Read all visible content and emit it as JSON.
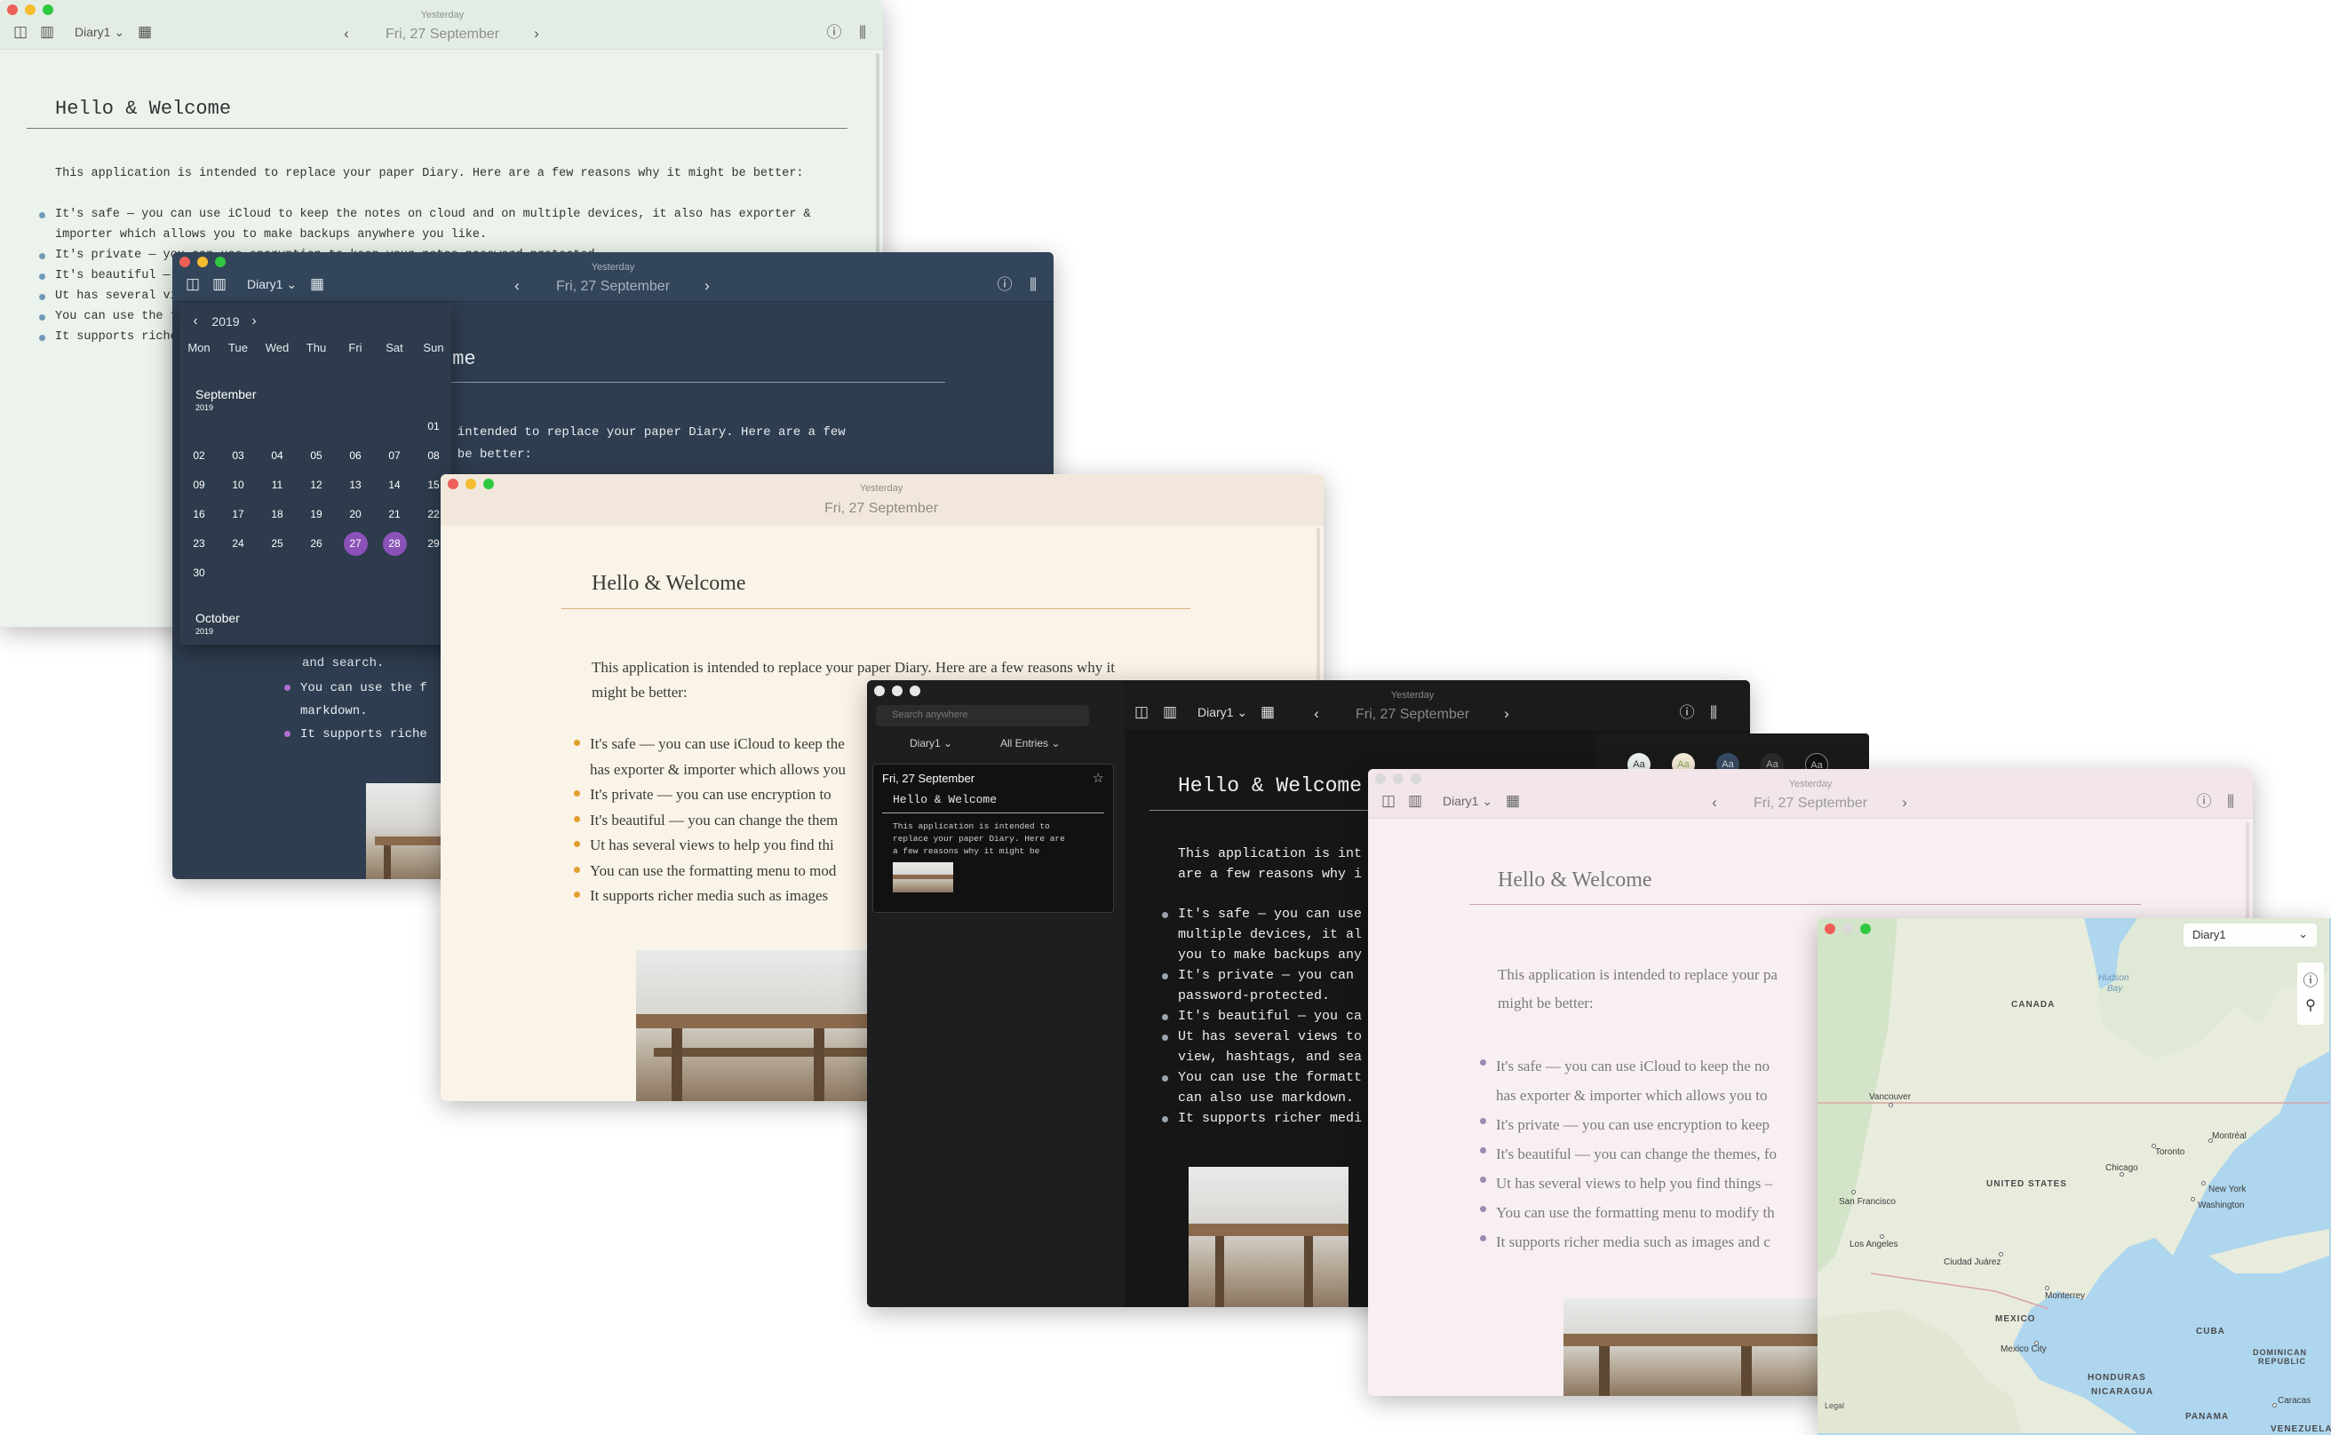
{
  "common": {
    "yesterday": "Yesterday",
    "date": "Fri, 27 September",
    "diary": "Diary1",
    "heading": "Hello & Welcome",
    "intro": "This application is intended to replace your paper Diary. Here are a few reasons why it might be better:",
    "intro_split_a": "This application is intended to replace your paper Diary. Here are a few",
    "intro_split_b": "reasons why it might be better:"
  },
  "win1": {
    "bullets": [
      "It's safe — you can use iCloud to keep the notes on cloud and on multiple devices, it also has exporter & importer which allows you to make backups anywhere you like.",
      "It's private — you can use encryption to keep your notes password-protected.",
      "It's beautiful — you can change the themes, fonts, colors and layout.",
      "Ut has several views to help you find things — timeline, calendar, map view, hashtags, and search.",
      "You can use the formatting menu to modify the text, or you can also use markdown.",
      "It supports richer media such as images and drawings."
    ],
    "bullets_clip": [
      "It's private — yo",
      "It's beautiful —",
      "Ut has several v",
      "You can use the",
      "It supports rich"
    ]
  },
  "win2": {
    "heading_clip": "ome",
    "intro_a": "s intended to replace your paper Diary. Here are a few",
    "intro_b": "t be better:",
    "tail": [
      "and search.",
      "You can use the f",
      "markdown.",
      "It supports riche"
    ]
  },
  "calendar": {
    "year": "2019",
    "weekdays": [
      "Mon",
      "Tue",
      "Wed",
      "Thu",
      "Fri",
      "Sat",
      "Sun"
    ],
    "month1": "September",
    "month1_year": "2019",
    "month2": "October",
    "month2_year": "2019",
    "weeks": [
      [
        "",
        "",
        "",
        "",
        "",
        "",
        "01"
      ],
      [
        "02",
        "03",
        "04",
        "05",
        "06",
        "07",
        "08"
      ],
      [
        "09",
        "10",
        "11",
        "12",
        "13",
        "14",
        "15"
      ],
      [
        "16",
        "17",
        "18",
        "19",
        "20",
        "21",
        "22"
      ],
      [
        "23",
        "24",
        "25",
        "26",
        "27",
        "28",
        "29"
      ],
      [
        "30",
        "",
        "",
        "",
        "",
        "",
        ""
      ]
    ],
    "selected": [
      "27",
      "28"
    ],
    "accent": "#8a52b8"
  },
  "win3": {
    "intro_a": "This application is intended to replace your paper Diary. Here are a few reasons why it",
    "intro_b": "might be better:",
    "bullets": [
      "It's safe — you can use iCloud to keep the",
      "has exporter & importer which allows you",
      "It's private — you can use encryption to",
      "It's beautiful — you can change the them",
      "Ut has several views to help you find thi",
      "You can use the formatting menu to mod",
      "It supports richer media such as images"
    ],
    "accent": "#e1a02e"
  },
  "win4": {
    "search_placeholder": "Search anywhere",
    "filter_diary": "Diary1",
    "filter_entries": "All Entries",
    "entry_date": "Fri, 27 September",
    "entry_title": "Hello & Welcome",
    "entry_excerpt": [
      "This application is intended to",
      "replace your paper Diary. Here are",
      "a few reasons why it might be"
    ],
    "intro_a": "This application is int",
    "intro_b": "are a few reasons why i",
    "bullets": [
      "It's safe — you can use",
      "multiple devices, it al",
      "you to make backups any",
      "It's private — you can",
      "password-protected.",
      "It's beautiful — you ca",
      "Ut has several views to",
      "view, hashtags, and sea",
      "You can use the formatt",
      "can also use markdown.",
      "It supports richer medi"
    ],
    "theme_label": "Aa"
  },
  "win5": {
    "intro_a": "This application is intended to replace your pa",
    "intro_b": "might be better:",
    "bullets": [
      "It's safe — you can use iCloud to keep the no",
      "has exporter & importer which allows you to",
      "It's private — you can use encryption to keep",
      "It's beautiful — you can change the themes, fo",
      "Ut has several views to help you find things –",
      "You can use the formatting menu to modify th",
      "It supports richer media such as images and c"
    ]
  },
  "map": {
    "diary": "Diary1",
    "legal": "Legal",
    "countries": [
      "CANADA",
      "UNITED STATES",
      "MEXICO",
      "CUBA",
      "DOMINICAN",
      "REPUBLIC",
      "HONDURAS",
      "NICARAGUA",
      "PANAMA",
      "VENEZUELA"
    ],
    "cities": [
      "Vancouver",
      "San Francisco",
      "Los Angeles",
      "Ciudad Juárez",
      "Chicago",
      "Toronto",
      "Montréal",
      "New York",
      "Washington",
      "Monterrey",
      "Mexico City",
      "Caracas"
    ],
    "water": [
      "Hudson",
      "Bay"
    ]
  }
}
